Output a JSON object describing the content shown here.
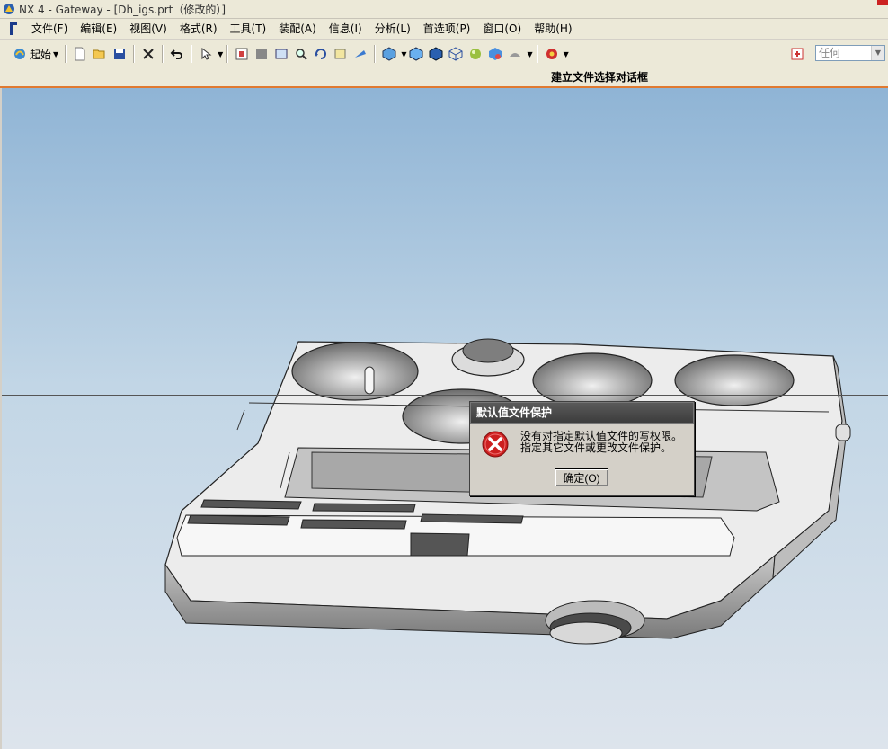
{
  "window": {
    "title": "NX 4 - Gateway - [Dh_igs.prt（修改的）]"
  },
  "menu": {
    "items": [
      "文件(F)",
      "编辑(E)",
      "视图(V)",
      "格式(R)",
      "工具(T)",
      "装配(A)",
      "信息(I)",
      "分析(L)",
      "首选项(P)",
      "窗口(O)",
      "帮助(H)"
    ]
  },
  "toolbar": {
    "start_label": "起始",
    "filter_value": "任何",
    "icons": [
      "new-icon",
      "open-icon",
      "save-icon",
      "delete-icon",
      "undo-icon",
      "select-icon",
      "fit-icon",
      "zoom-window-icon",
      "zoom-icon",
      "rotate-icon",
      "snap-view-icon",
      "view-orient-icon",
      "shaded-icon",
      "wireframe-icon",
      "studio-icon",
      "render-icon",
      "face-analysis-icon",
      "render-style-icon",
      "help-icon"
    ]
  },
  "cue_line": {
    "text": "建立文件选择对话框"
  },
  "dialog": {
    "title": "默认值文件保护",
    "line1": "没有对指定默认值文件的写权限。",
    "line2": "指定其它文件或更改文件保护。",
    "ok_label": "确定(O)",
    "icon": "error-icon"
  },
  "colors": {
    "viewport_top": "#8fb4d5",
    "viewport_bottom": "#dde4ec",
    "cue_border": "#e07a30",
    "error_red": "#cc1f1f"
  }
}
